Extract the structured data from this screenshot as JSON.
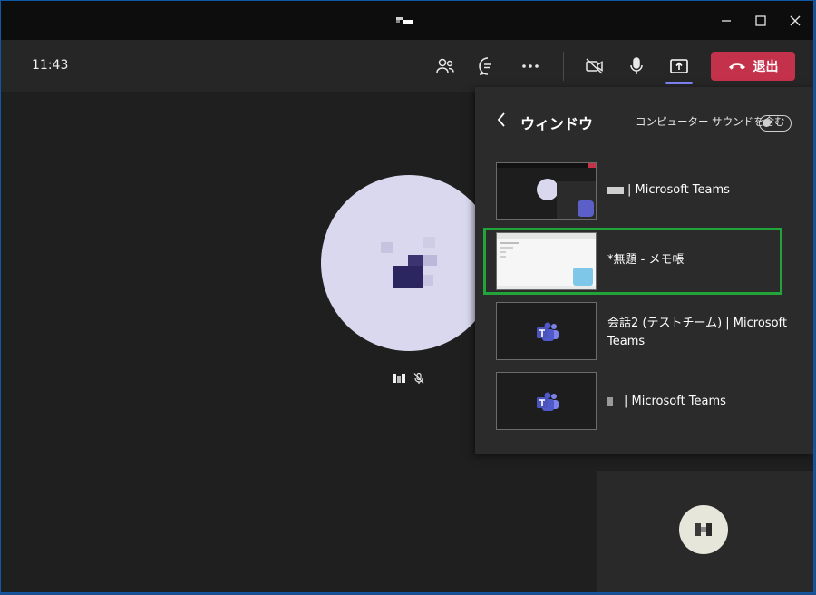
{
  "titlebar": {
    "controls": {
      "minimize_icon": "minimize-icon",
      "maximize_icon": "maximize-icon",
      "close_icon": "close-icon"
    }
  },
  "toolbar": {
    "time": "11:43",
    "leave_label": "退出",
    "icons": [
      "people-icon",
      "chat-icon",
      "more-icon",
      "camera-off-icon",
      "mic-icon",
      "share-screen-icon"
    ],
    "accent_color": "#7f85f5",
    "leave_color": "#c4314b"
  },
  "share_panel": {
    "title": "ウィンドウ",
    "include_sound_label": "コンピューター サウンドを含む",
    "include_sound_on": false,
    "windows": [
      {
        "label": "| Microsoft Teams",
        "selected": false
      },
      {
        "label": "*無題 - メモ帳",
        "selected": true
      },
      {
        "label": "会話2 (テストチーム) | Microsoft Teams",
        "selected": false
      },
      {
        "label": "| Microsoft Teams",
        "selected": false
      }
    ],
    "selection_color": "#22a43a"
  }
}
